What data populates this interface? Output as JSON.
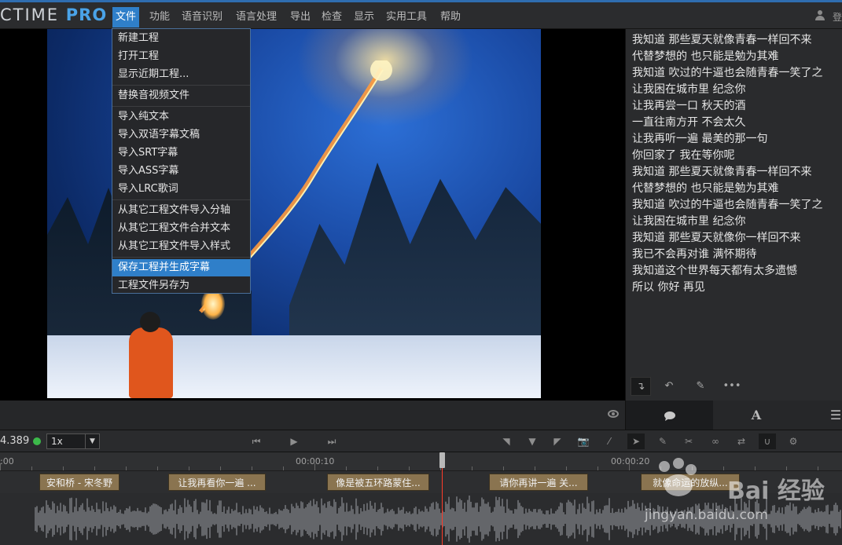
{
  "app": {
    "logo_main": "CTIME",
    "logo_pro": "PRO"
  },
  "menubar": {
    "items": [
      "文件",
      "功能",
      "语音识别",
      "语言处理",
      "导出",
      "检查",
      "显示",
      "实用工具",
      "帮助"
    ],
    "user_label": "登"
  },
  "file_menu": {
    "items": [
      "新建工程",
      "打开工程",
      "显示近期工程...",
      "替换音视频文件",
      "导入纯文本",
      "导入双语字幕文稿",
      "导入SRT字幕",
      "导入ASS字幕",
      "导入LRC歌词",
      "从其它工程文件导入分轴",
      "从其它工程文件合并文本",
      "从其它工程文件导入样式",
      "保存工程并生成字幕",
      "工程文件另存为"
    ],
    "highlighted": "保存工程并生成字幕"
  },
  "subtitles": {
    "lines": [
      " 我知道 那些夏天就像青春一样回不来",
      " 代替梦想的 也只能是勉为其难",
      " 我知道 吹过的牛逼也会随青春一笑了之",
      " 让我困在城市里 纪念你",
      " 让我再尝一口 秋天的酒",
      " 一直往南方开 不会太久",
      " 让我再听一遍 最美的那一句",
      " 你回家了 我在等你呢",
      " 我知道 那些夏天就像青春一样回不来",
      "代替梦想的 也只能是勉为其难",
      " 我知道 吹过的牛逼也会随青春一笑了之",
      "让我困在城市里 纪念你",
      "我知道 那些夏天就像你一样回不来",
      "我已不会再对谁 满怀期待",
      "我知道这个世界每天都有太多遗憾",
      "所以 你好 再见"
    ],
    "toolbar_icons": [
      "insert-icon",
      "undo-icon",
      "edit-icon",
      "more-icon"
    ],
    "tabs": [
      "comment-icon",
      "A",
      "list-icon"
    ]
  },
  "transport": {
    "timecode": "4.389",
    "speed": "1x",
    "status_color": "#3cb94a"
  },
  "timeline": {
    "ruler_labels": [
      ":00",
      "00:00:10",
      "00:00:20"
    ],
    "clips": [
      "安和桥 - 宋冬野",
      "让我再看你一遍 ...",
      "像是被五环路蒙住...",
      "请你再讲一遍 关...",
      "就像命运的放纵..."
    ],
    "playhead_color": "#ff3c2a"
  },
  "watermark": {
    "brand": "Bai 经验",
    "url": "jingyan.baidu.com"
  },
  "colors": {
    "accent": "#2f7fc9",
    "menu_border": "#4a6f9a",
    "clip": "#8a7450"
  }
}
